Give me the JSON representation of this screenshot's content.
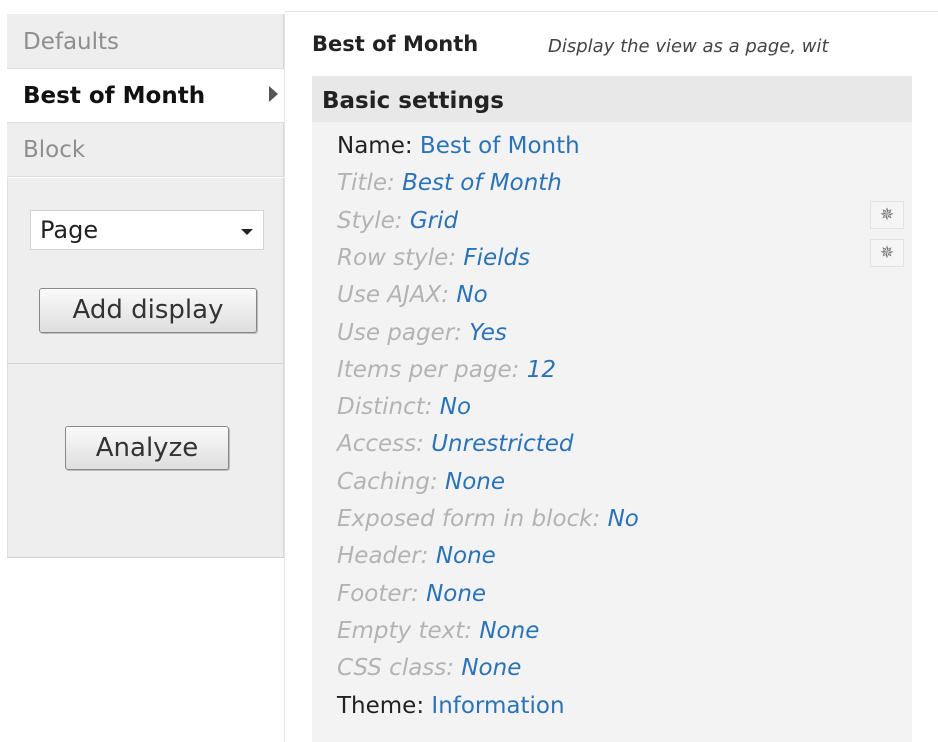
{
  "tabs": {
    "defaults": "Defaults",
    "active": "Best of Month",
    "block": "Block"
  },
  "display_type_select": {
    "value": "Page"
  },
  "buttons": {
    "add_display": "Add display",
    "analyze": "Analyze"
  },
  "display": {
    "title": "Best of Month",
    "description": "Display the view as a page, wit"
  },
  "basic_settings": {
    "heading": "Basic settings",
    "rows": [
      {
        "label": "Name:",
        "value": "Best of Month"
      },
      {
        "label": "Title:",
        "value": "Best of Month"
      },
      {
        "label": "Style:",
        "value": "Grid"
      },
      {
        "label": "Row style:",
        "value": "Fields"
      },
      {
        "label": "Use AJAX:",
        "value": "No"
      },
      {
        "label": "Use pager:",
        "value": "Yes"
      },
      {
        "label": "Items per page:",
        "value": "12"
      },
      {
        "label": "Distinct:",
        "value": "No"
      },
      {
        "label": "Access:",
        "value": "Unrestricted"
      },
      {
        "label": "Caching:",
        "value": "None"
      },
      {
        "label": "Exposed form in block:",
        "value": "No"
      },
      {
        "label": "Header:",
        "value": "None"
      },
      {
        "label": "Footer:",
        "value": "None"
      },
      {
        "label": "Empty text:",
        "value": "None"
      },
      {
        "label": "CSS class:",
        "value": "None"
      },
      {
        "label": "Theme:",
        "value": "Information"
      }
    ]
  },
  "icons": {
    "gear": "gear-icon",
    "arrow": "arrow-right-icon",
    "dropdown": "chevron-down-icon"
  },
  "colors": {
    "link": "#2b73b8",
    "muted_label": "#b3b3b3",
    "panel_bg": "#eeeeee",
    "settings_bg": "#f3f3f3"
  }
}
